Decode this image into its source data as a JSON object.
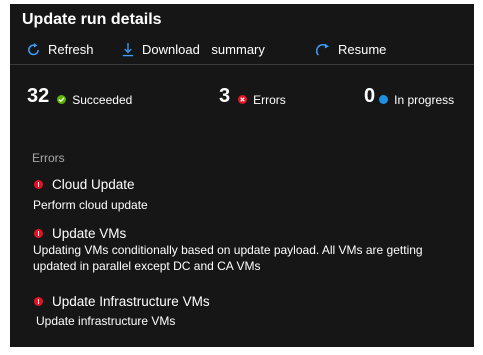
{
  "header": {
    "title": "Update run details"
  },
  "toolbar": {
    "refresh": {
      "label": "Refresh",
      "icon": "refresh-icon"
    },
    "download": {
      "label": "Download summary",
      "icon": "download-icon"
    },
    "resume": {
      "label": "Resume",
      "icon": "resume-icon"
    }
  },
  "stats": {
    "succeeded": {
      "count": "32",
      "label": "Succeeded",
      "color": "#5db300"
    },
    "errors": {
      "count": "3",
      "label": "Errors",
      "color": "#e81123"
    },
    "in_progress": {
      "count": "0",
      "label": "In progress",
      "color": "#1e90e0"
    }
  },
  "errors_section": {
    "label": "Errors",
    "items": [
      {
        "title": "Cloud Update",
        "description": "Perform cloud update"
      },
      {
        "title": "Update VMs",
        "description": "Updating VMs conditionally based on update payload. All VMs are getting updated in parallel except DC and CA VMs"
      },
      {
        "title": "Update Infrastructure VMs",
        "description": "Update infrastructure VMs"
      }
    ]
  },
  "colors": {
    "panel_bg": "#161616",
    "accent": "#3b9eff",
    "error": "#e81123"
  }
}
